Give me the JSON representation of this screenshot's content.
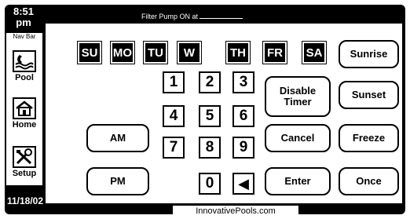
{
  "header": {
    "time": "8:51 pm",
    "message": "Filter Pump ON at"
  },
  "sidebar": {
    "title": "Nav Bar",
    "items": [
      {
        "label": "Pool",
        "icon": "pool-icon"
      },
      {
        "label": "Home",
        "icon": "home-icon"
      },
      {
        "label": "Setup",
        "icon": "tools-icon"
      }
    ]
  },
  "days": [
    "SU",
    "MO",
    "TU",
    "W",
    "TH",
    "FR",
    "SA"
  ],
  "keypad": [
    "1",
    "2",
    "3",
    "4",
    "5",
    "6",
    "7",
    "8",
    "9",
    "0",
    "←"
  ],
  "buttons": {
    "am": "AM",
    "pm": "PM",
    "disable_timer": "Disable Timer",
    "cancel": "Cancel",
    "enter": "Enter",
    "sunrise": "Sunrise",
    "sunset": "Sunset",
    "freeze": "Freeze",
    "once": "Once"
  },
  "footer": {
    "date": "11/18/02",
    "site": "InnovativePools.com"
  }
}
